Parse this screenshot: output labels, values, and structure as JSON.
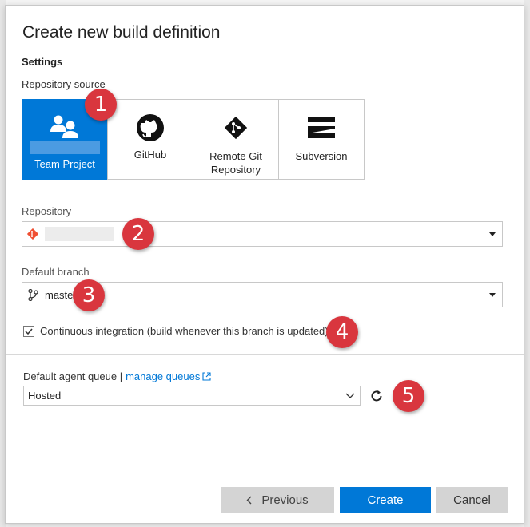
{
  "dialog": {
    "title": "Create new build definition",
    "settings_heading": "Settings",
    "repository_source_label": "Repository source",
    "sources": [
      {
        "label": "Team Project",
        "icon": "team-project-icon",
        "selected": true
      },
      {
        "label": "GitHub",
        "icon": "github-icon",
        "selected": false
      },
      {
        "label": "Remote Git Repository",
        "icon": "git-icon",
        "selected": false
      },
      {
        "label": "Subversion",
        "icon": "subversion-icon",
        "selected": false
      }
    ],
    "repository_label": "Repository",
    "repository_value": "",
    "default_branch_label": "Default branch",
    "default_branch_value": "master",
    "ci_checked": true,
    "ci_label": "Continuous integration (build whenever this branch is updated)",
    "agent_queue_label": "Default agent queue |",
    "manage_queues_link": "manage queues",
    "agent_queue_value": "Hosted",
    "buttons": {
      "previous": "Previous",
      "create": "Create",
      "cancel": "Cancel"
    }
  },
  "callouts": [
    "1",
    "2",
    "3",
    "4",
    "5"
  ],
  "colors": {
    "accent": "#0078d7",
    "callout": "#d9363e",
    "git": "#f05033"
  }
}
